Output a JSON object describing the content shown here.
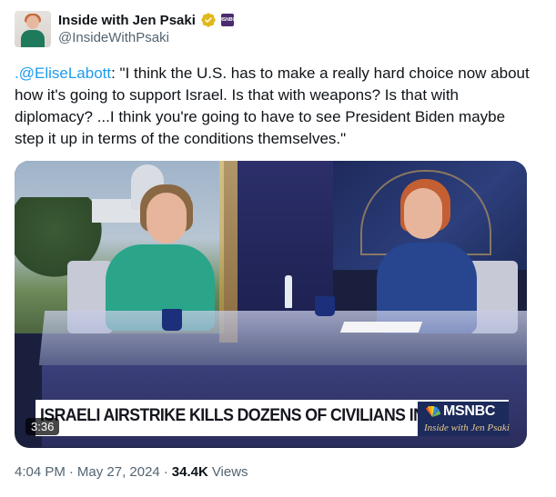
{
  "author": {
    "display_name": "Inside with Jen Psaki",
    "handle": "@InsideWithPsaki",
    "affiliate_badge": "MSNBC"
  },
  "tweet": {
    "mention": ".@EliseLabott",
    "text": ": \"I think the U.S. has to make a really hard choice now about how it's going to support Israel. Is that with weapons? Is that with diplomacy? ...I think you're going to have to see President Biden maybe step it up in terms of the conditions themselves.\""
  },
  "media": {
    "chyron": "ISRAELI AIRSTRIKE KILLS DOZENS OF CIVILIANS IN RAFAH",
    "network": "MSNBC",
    "show_bug": "Inside with Jen Psaki",
    "duration": "3:36"
  },
  "meta": {
    "time": "4:04 PM",
    "separator1": "·",
    "date": "May 27, 2024",
    "separator2": "·",
    "views_count": "34.4K",
    "views_label": "Views"
  },
  "colors": {
    "link": "#1d9bf0",
    "verified": "#e2b719",
    "text": "#0f1419",
    "secondary": "#536471"
  },
  "icons": [
    "verified-badge-icon",
    "affiliate-badge-icon",
    "peacock-icon"
  ]
}
